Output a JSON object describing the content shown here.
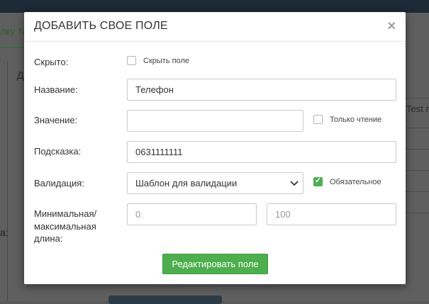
{
  "background": {
    "tab_label": "лку №",
    "tab2_label": "Д",
    "side_label": "а:",
    "right_text": "Test r"
  },
  "modal": {
    "title": "ДОБАВИТЬ СВОЕ ПОЛЕ",
    "close_symbol": "×",
    "hidden": {
      "label": "Скрыто:",
      "checkbox_label": "Скрыть поле",
      "checked": false
    },
    "name": {
      "label": "Название:",
      "value": "Телефон"
    },
    "value": {
      "label": "Значение:",
      "value": "",
      "readonly_label": "Только чтение",
      "readonly_checked": false
    },
    "hint": {
      "label": "Подсказка:",
      "value": "0631111111"
    },
    "validation": {
      "label": "Валидация:",
      "selected": "Шаблон для валидации",
      "required_label": "Обязательное",
      "required_checked": true
    },
    "length": {
      "label_line1": "Минимальная/",
      "label_line2": "максимальная",
      "label_line3": "длина:",
      "min_placeholder": "0",
      "max_placeholder": "100"
    },
    "submit_label": "Редактировать поле"
  },
  "colors": {
    "accent_green": "#4cae4c",
    "topbar": "#1b2a36"
  }
}
